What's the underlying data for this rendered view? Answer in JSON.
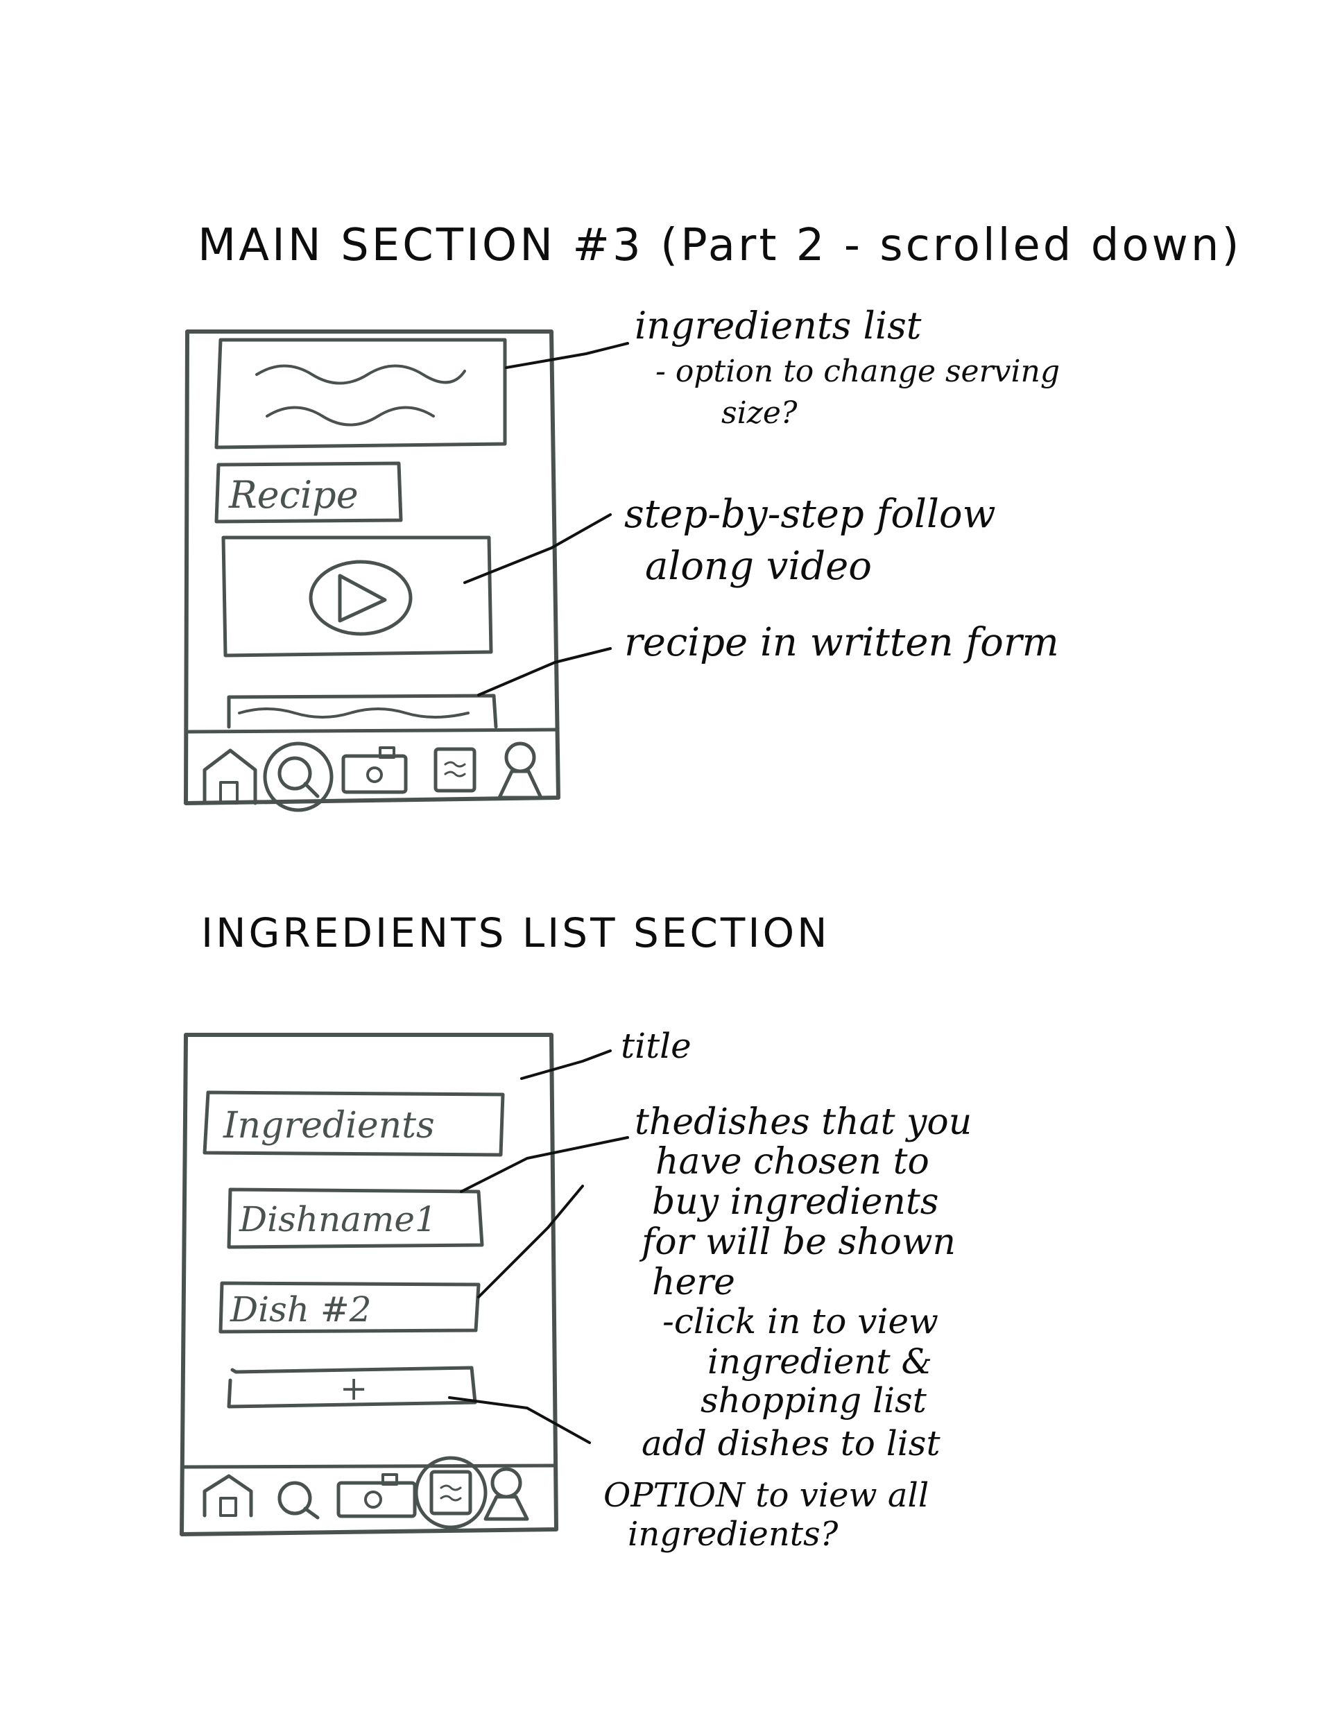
{
  "heading_main": "MAIN SECTION #3 (Part 2 - scrolled down)",
  "heading_ingredients": "INGREDIENTS LIST SECTION",
  "phone1": {
    "recipe_label": "Recipe",
    "tabs": [
      "home-icon",
      "search-icon",
      "camera-icon",
      "list-icon",
      "profile-icon"
    ],
    "active_tab": "search-icon"
  },
  "phone2": {
    "title_label": "Ingredients",
    "dish1_label": "Dishname1",
    "dish2_label": "Dish #2",
    "add_label": "+",
    "tabs": [
      "home-icon",
      "search-icon",
      "camera-icon",
      "list-icon",
      "profile-icon"
    ],
    "active_tab": "list-icon"
  },
  "annotations": {
    "ingredients_list": [
      "ingredients list",
      "- option to change serving",
      "size?"
    ],
    "video": [
      "step-by-step follow",
      "along video"
    ],
    "written": [
      "recipe in written form"
    ],
    "title": [
      "title"
    ],
    "dishes": [
      "thedishes that you",
      "have chosen to",
      "buy ingredients",
      "for will be shown",
      "here"
    ],
    "click": [
      "-click in to view",
      "ingredient &",
      "shopping list"
    ],
    "add": [
      "add dishes to list"
    ],
    "option": [
      "OPTION to view all",
      "ingredients?"
    ]
  },
  "colors": {
    "ink": "#111111",
    "frame": "#4a5250",
    "paper": "#ffffff"
  }
}
